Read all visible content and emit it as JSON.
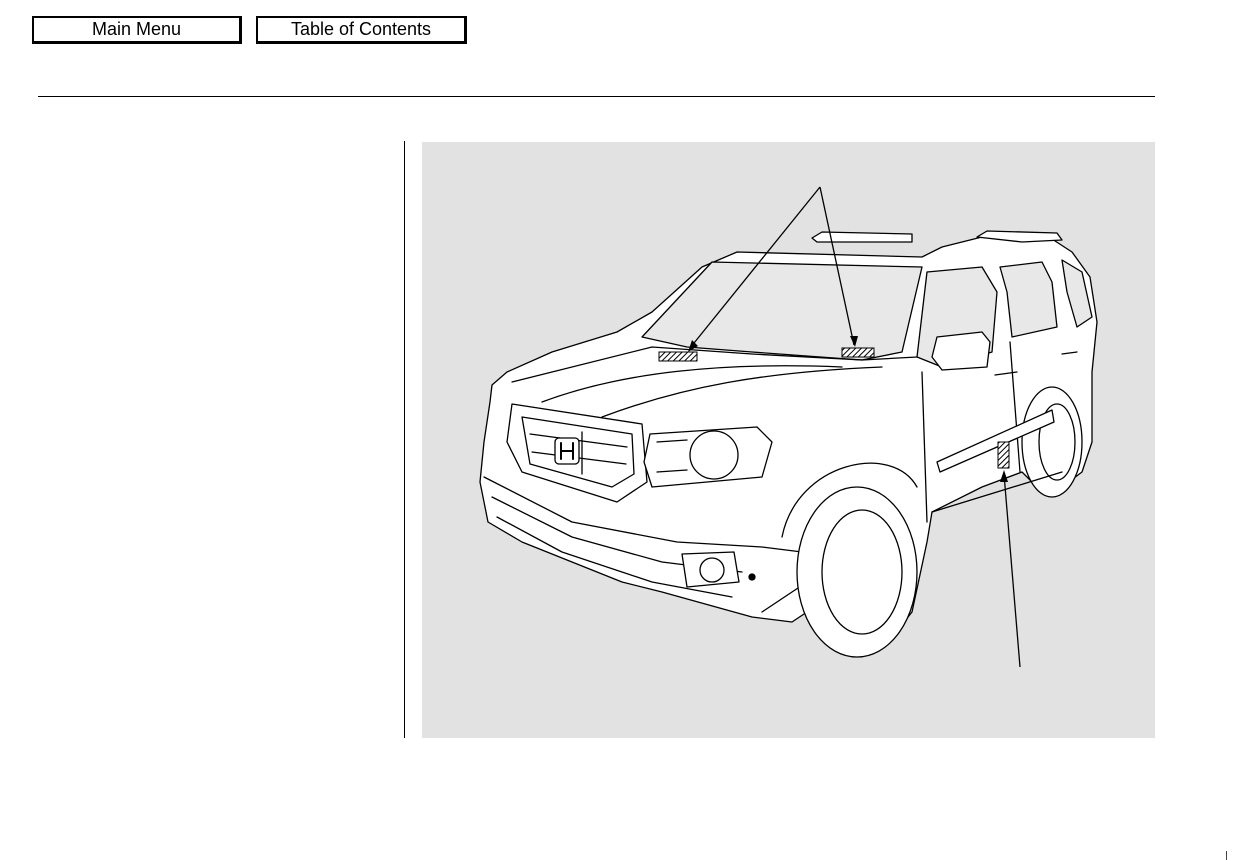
{
  "nav": {
    "main_menu_label": "Main Menu",
    "table_of_contents_label": "Table of Contents"
  },
  "figure": {
    "background": "#e2e2e2",
    "stroke": "#000000",
    "label_icon": "hatched-label-icon"
  }
}
